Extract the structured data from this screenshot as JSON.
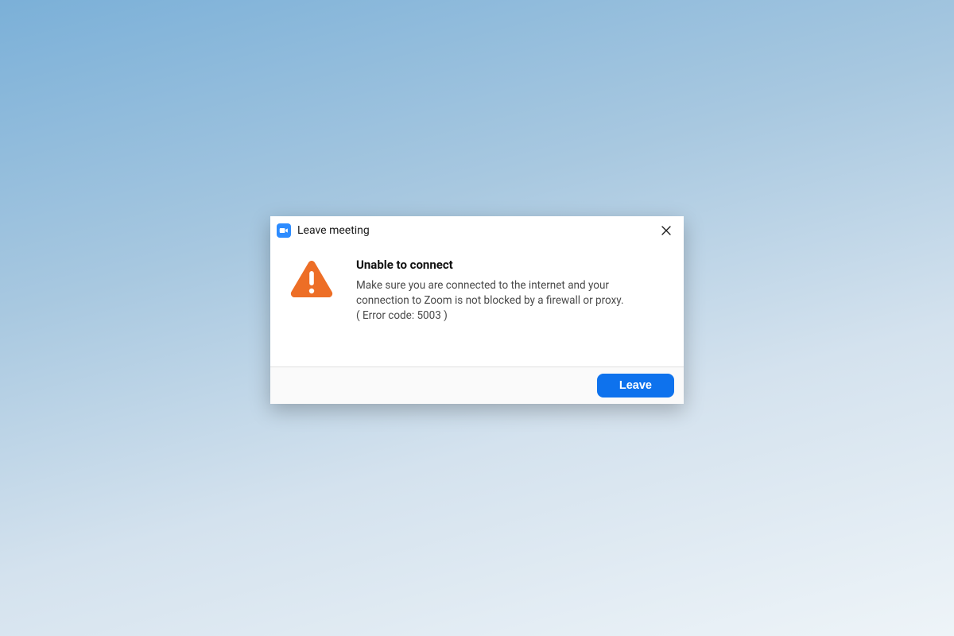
{
  "dialog": {
    "title": "Leave meeting",
    "headline": "Unable to connect",
    "message": "Make sure you are connected to the internet and your connection to Zoom is not blocked by a firewall or proxy.",
    "error_code": "( Error code: 5003 )",
    "leave_button": "Leave"
  },
  "colors": {
    "primary": "#0e72ed",
    "warning": "#ed6e26"
  }
}
